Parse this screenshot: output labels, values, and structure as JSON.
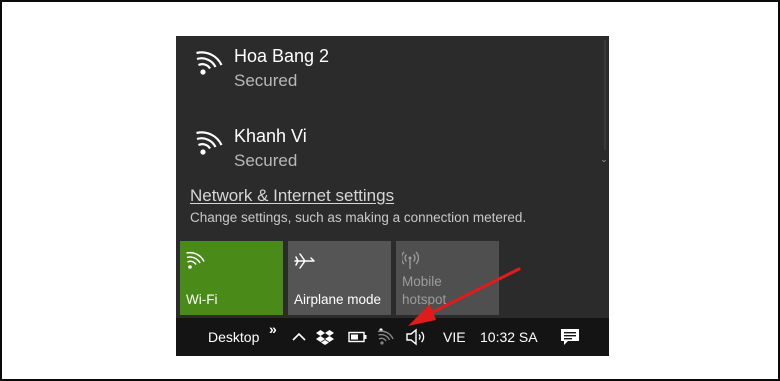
{
  "networks": [
    {
      "name": "Hoa Bang 2",
      "status": "Secured",
      "icon": "wifi-icon"
    },
    {
      "name": "Khanh Vi",
      "status": "Secured",
      "icon": "wifi-icon"
    }
  ],
  "settings": {
    "link": "Network & Internet settings",
    "description": "Change settings, such as making a connection metered."
  },
  "tiles": {
    "wifi": {
      "label": "Wi-Fi",
      "icon": "wifi-icon",
      "active": true,
      "color": "#4a8a19"
    },
    "airplane": {
      "label": "Airplane mode",
      "icon": "airplane-icon"
    },
    "hotspot": {
      "label_line1": "Mobile",
      "label_line2": "hotspot",
      "icon": "hotspot-icon",
      "disabled": true
    }
  },
  "taskbar": {
    "desktop_label": "Desktop",
    "desktop_chevron": "»",
    "tray_icons": [
      "show-hidden-icons",
      "dropbox-icon",
      "battery-icon",
      "network-icon",
      "volume-icon"
    ],
    "language": "VIE",
    "time": "10:32 SA",
    "notification_icon": "action-center-icon"
  },
  "annotation": {
    "arrow_color": "#e01b1b"
  }
}
